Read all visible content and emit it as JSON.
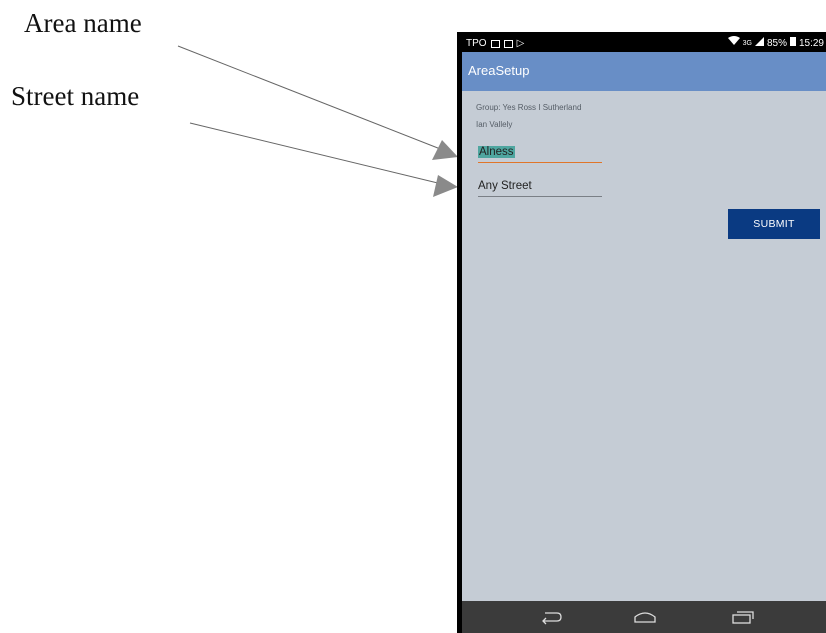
{
  "annotations": {
    "area_label": "Area name",
    "street_label": "Street name"
  },
  "status_bar": {
    "left_text": "TPO",
    "network": "3G",
    "battery": "85%",
    "time": "15:29"
  },
  "app": {
    "title": "AreaSetup"
  },
  "group_info": {
    "line1": "Group: Yes Ross I Sutherland",
    "line2": "Ian Vallely"
  },
  "form": {
    "area_value": "Alness",
    "street_value": "Any Street",
    "submit_label": "SUBMIT"
  },
  "colors": {
    "app_bar": "#688ec6",
    "screen_bg": "#c5ccd5",
    "submit_bg": "#0a3a82",
    "focused_underline": "#e0752a"
  },
  "nav": {
    "icons": [
      "back-icon",
      "home-icon",
      "recent-apps-icon"
    ]
  }
}
